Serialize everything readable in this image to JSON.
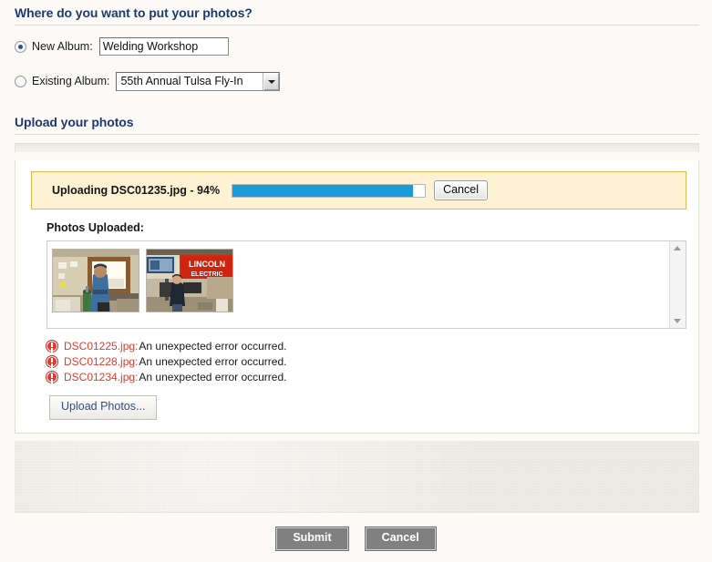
{
  "album_section": {
    "heading": "Where do you want to put your photos?",
    "new_album": {
      "label": "New Album:",
      "value": "Welding Workshop",
      "placeholder": "",
      "selected": true
    },
    "existing_album": {
      "label": "Existing Album:",
      "value": "55th Annual Tulsa Fly-In",
      "selected": false
    }
  },
  "upload_section": {
    "heading": "Upload your photos",
    "banner": {
      "status_text": "Uploading DSC01235.jpg - 94%",
      "file_name": "DSC01235.jpg",
      "percent": 94,
      "progress_color": "#1a9ad6",
      "cancel_label": "Cancel"
    },
    "photos_label": "Photos Uploaded:",
    "thumbnails": [
      {
        "alt": "Man in blue shirt standing in a welding workshop beside a gas cylinder with a bright window behind him"
      },
      {
        "alt": "Person standing in a shop below a red LINCOLN ELECTRIC banner",
        "banner_line1": "LINCOLN",
        "banner_line2": "ELECTRIC"
      }
    ],
    "errors": [
      {
        "file": "DSC01225.jpg:",
        "message": "An unexpected error occurred."
      },
      {
        "file": "DSC01228.jpg:",
        "message": "An unexpected error occurred."
      },
      {
        "file": "DSC01234.jpg:",
        "message": "An unexpected error occurred."
      }
    ],
    "upload_button_label": "Upload Photos..."
  },
  "footer": {
    "submit_label": "Submit",
    "cancel_label": "Cancel"
  }
}
